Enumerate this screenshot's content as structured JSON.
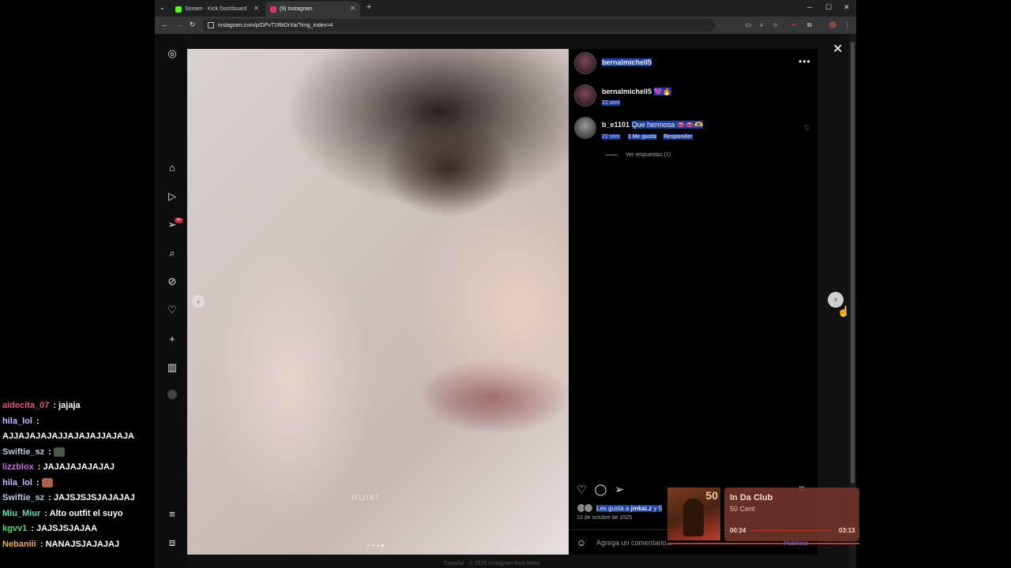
{
  "browser": {
    "tabs": [
      {
        "label": "Stream - Kick Dashboard",
        "icon": "kick-icon",
        "color": "#53fc18"
      },
      {
        "label": "(9) Instagram",
        "icon": "instagram-icon",
        "color": "#e1306c"
      }
    ],
    "url": "instagram.com/p/DPvT1RkDrXa/?img_index=4"
  },
  "instagram": {
    "sidebar": [
      "instagram-logo-icon",
      "home-icon",
      "reels-icon",
      "messages-icon",
      "search-icon",
      "explore-icon",
      "notifications-icon",
      "create-icon",
      "dashboard-icon",
      "profile-icon",
      "menu-icon",
      "meta-icon"
    ],
    "messages_badge": "9+",
    "photo_watermark": "RUIXI",
    "post": {
      "author": "bernalmichell5",
      "caption_author": "bernalmichell5",
      "caption_emojis": "💜🔥",
      "caption_time": "22 sem",
      "comments": [
        {
          "user": "b_e1101",
          "text": "Que hermosa",
          "emojis": "👄👄🫶",
          "time": "22 sem",
          "likes": "1 Me gusta",
          "reply": "Responder"
        }
      ],
      "view_replies": "Ver respuestas (1)",
      "likes_text": "Les gusta a",
      "likes_user": "jmkai.z",
      "likes_more": "y 5",
      "date": "13 de octubre de 2025",
      "comment_placeholder": "Agrega un comentario...",
      "publish": "Publicar"
    },
    "footer": "Español  ·  © 2026 Instagram from Meta"
  },
  "chat": [
    {
      "user": "aidecita_07",
      "color": "#e0587a",
      "text": "jajaja"
    },
    {
      "user": "hila_lol",
      "color": "#c9b6ff",
      "text": ""
    },
    {
      "user": "",
      "color": "#ffffff",
      "text": "AJJAJAJAJAJJAJAJAJJAJAJA"
    },
    {
      "user": "Swiftie_sz",
      "color": "#b9c9e6",
      "text": "",
      "emote": "#4a5a40"
    },
    {
      "user": "lizzblox",
      "color": "#c06ce0",
      "text": "JAJAJAJAJAJAJ"
    },
    {
      "user": "hila_lol",
      "color": "#c9b6ff",
      "text": "",
      "emote": "#b0604a"
    },
    {
      "user": "Swiftie_sz",
      "color": "#b9c9e6",
      "text": "JAJSJSJSJAJAJAJ"
    },
    {
      "user": "Miu_Miur",
      "color": "#5de0b0",
      "text": "Alto outfit el suyo"
    },
    {
      "user": "kgvv1",
      "color": "#53d86a",
      "text": "JAJSJSJAJAA"
    },
    {
      "user": "Nebaniii",
      "color": "#e8b04a",
      "text": "NANAJSJAJAJAJ"
    }
  ],
  "music": {
    "title": "In Da Club",
    "artist": "50 Cent",
    "cover_text": "50",
    "elapsed": "00:24",
    "duration": "03:13",
    "progress": 0.12
  }
}
